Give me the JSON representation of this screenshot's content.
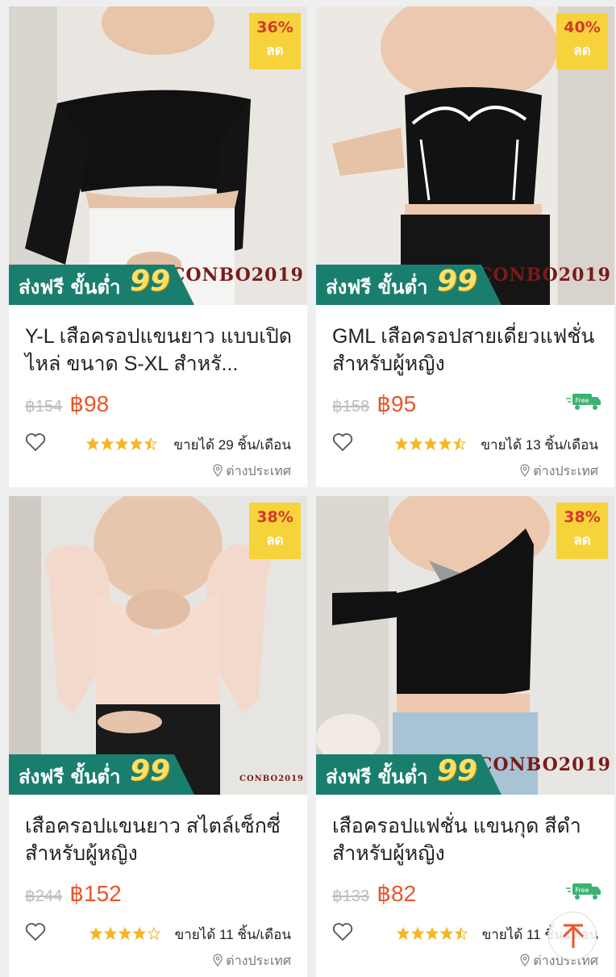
{
  "products": [
    {
      "discount_pct": "36%",
      "discount_label": "ลด",
      "shipping_text": "ส่งฟรี ขั้นต่ำ",
      "shipping_min": "99",
      "title": "Y-L เสือครอปแขนยาว แบบเปิดไหล่ ขนาด S-XL  สำหรั...",
      "old_price": "฿154",
      "new_price": "฿98",
      "rating": 4.5,
      "sold": "ขายได้ 29 ชิ้น/เดือน",
      "location": "ต่างประเทศ",
      "free_ship_badge": false,
      "brand_watermark": "CONBO2019"
    },
    {
      "discount_pct": "40%",
      "discount_label": "ลด",
      "shipping_text": "ส่งฟรี ขั้นต่ำ",
      "shipping_min": "99",
      "title": "GML เสือครอปสายเดี่ยวแฟชั่นสำหรับผู้หญิง",
      "old_price": "฿158",
      "new_price": "฿95",
      "rating": 4.5,
      "sold": "ขายได้ 13 ชิ้น/เดือน",
      "location": "ต่างประเทศ",
      "free_ship_badge": true,
      "free_label": "Free",
      "brand_watermark": "CONBO2019"
    },
    {
      "discount_pct": "38%",
      "discount_label": "ลด",
      "shipping_text": "ส่งฟรี ขั้นต่ำ",
      "shipping_min": "99",
      "title": "เสือครอปแขนยาว สไตล์เซ็กซี่สำหรับผู้หญิง",
      "old_price": "฿244",
      "new_price": "฿152",
      "rating": 4,
      "sold": "ขายได้ 11 ชิ้น/เดือน",
      "location": "ต่างประเทศ",
      "free_ship_badge": false,
      "brand_watermark": "CONBO2019"
    },
    {
      "discount_pct": "38%",
      "discount_label": "ลด",
      "shipping_text": "ส่งฟรี ขั้นต่ำ",
      "shipping_min": "99",
      "title": "เสือครอปแฟชั่น แขนกุด สีดำสำหรับผู้หญิง",
      "old_price": "฿133",
      "new_price": "฿82",
      "rating": 4.5,
      "sold": "ขายได้ 11 ชิ้น/เดือน",
      "location": "ต่างประเทศ",
      "free_ship_badge": true,
      "free_label": "Free",
      "brand_watermark": "CONBO2019"
    }
  ],
  "colors": {
    "discount_bg": "#f7d33b",
    "discount_text": "#d6372f",
    "price": "#e8562a",
    "shipping_bg": "#1a7e6f",
    "star": "#f5b622",
    "free_badge": "#3cb371"
  },
  "icons": {
    "wishlist": "heart-outline-icon",
    "location": "pin-icon",
    "free_shipping": "truck-icon",
    "back_to_top": "arrow-up-icon"
  }
}
